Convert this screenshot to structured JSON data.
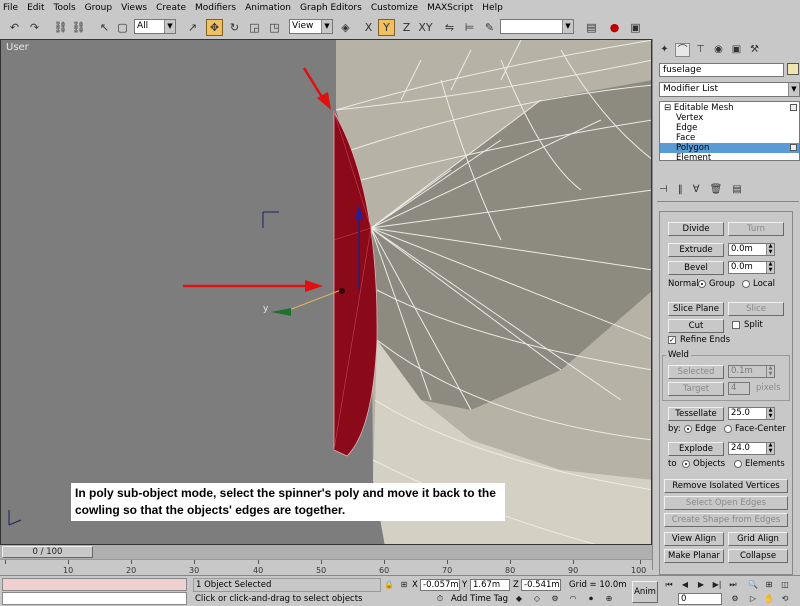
{
  "menu": [
    "File",
    "Edit",
    "Tools",
    "Group",
    "Views",
    "Create",
    "Modifiers",
    "Animation",
    "Graph Editors",
    "Customize",
    "MAXScript",
    "Help"
  ],
  "toolbar": {
    "selection_filter": "All",
    "ref_coord": "View",
    "named_selection": ""
  },
  "viewport": {
    "label": "User",
    "annotation": "In poly sub-object mode, select the spinner's poly and move it back to the cowling so that the objects' edges are together.",
    "axis_y": "y"
  },
  "command_panel": {
    "object_name": "fuselage",
    "object_color": "#f0e4b0",
    "modifier_list": "Modifier List",
    "stack": [
      {
        "label": "Editable Mesh",
        "level": 0
      },
      {
        "label": "Vertex",
        "level": 1
      },
      {
        "label": "Edge",
        "level": 1
      },
      {
        "label": "Face",
        "level": 1
      },
      {
        "label": "Polygon",
        "level": 1,
        "selected": true
      },
      {
        "label": "Element",
        "level": 1
      }
    ],
    "divide": "Divide",
    "turn": "Turn",
    "extrude": "Extrude",
    "extrude_val": "0.0m",
    "bevel": "Bevel",
    "bevel_val": "0.0m",
    "normal_label": "Normal:",
    "group": "Group",
    "local": "Local",
    "slice_plane": "Slice Plane",
    "slice": "Slice",
    "cut": "Cut",
    "split": "Split",
    "refine_ends": "Refine Ends",
    "weld_title": "Weld",
    "selected": "Selected",
    "selected_val": "0.1m",
    "target": "Target",
    "target_val": "4",
    "pixels": "pixels",
    "tessellate": "Tessellate",
    "tessellate_val": "25.0",
    "by_label": "by:",
    "edge": "Edge",
    "face_center": "Face-Center",
    "explode": "Explode",
    "explode_val": "24.0",
    "to_label": "to",
    "objects": "Objects",
    "elements": "Elements",
    "remove_isolated": "Remove Isolated Vertices",
    "select_open_edges": "Select Open Edges",
    "create_shape": "Create Shape from Edges",
    "view_align": "View Align",
    "grid_align": "Grid Align",
    "make_planar": "Make Planar",
    "collapse": "Collapse"
  },
  "timeline": {
    "slider": "0 / 100",
    "ticks": [
      "10",
      "20",
      "30",
      "40",
      "50",
      "60",
      "70",
      "80",
      "90",
      "100"
    ]
  },
  "status": {
    "selected": "1 Object Selected",
    "prompt": "Click or click-and-drag to select objects",
    "x_label": "X",
    "x": "-0.057m",
    "y_label": "Y",
    "y": "1.67m",
    "z_label": "Z",
    "z": "-0.541m",
    "grid": "Grid = 10.0m",
    "add_time_tag": "Add Time Tag",
    "anim": "Anim",
    "frame": "0"
  }
}
